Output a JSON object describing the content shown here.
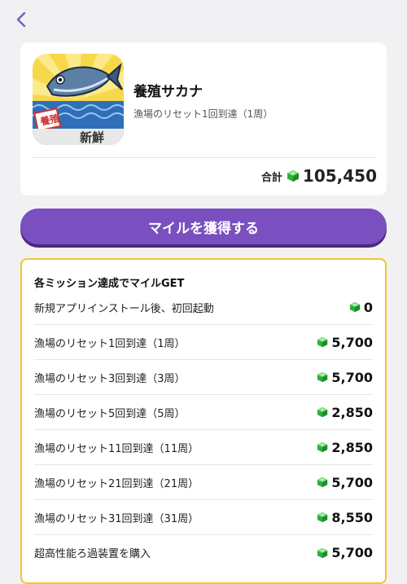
{
  "app": {
    "name": "養殖サカナ",
    "subtitle": "漁場のリセット1回到達（1周）",
    "icon_badge_left": "養殖",
    "icon_badge_bottom": "新鮮"
  },
  "total": {
    "label": "合計",
    "value": "105,450"
  },
  "earn_button": {
    "label": "マイルを獲得する"
  },
  "missions": {
    "title": "各ミッション達成でマイルGET",
    "rows": [
      {
        "label": "新規アプリインストール後、初回起動",
        "value": "0"
      },
      {
        "label": "漁場のリセット1回到達（1周）",
        "value": "5,700"
      },
      {
        "label": "漁場のリセット3回到達（3周）",
        "value": "5,700"
      },
      {
        "label": "漁場のリセット5回到達（5周）",
        "value": "2,850"
      },
      {
        "label": "漁場のリセット11回到達（11周）",
        "value": "2,850"
      },
      {
        "label": "漁場のリセット21回到達（21周）",
        "value": "5,700"
      },
      {
        "label": "漁場のリセット31回到達（31周）",
        "value": "8,550"
      },
      {
        "label": "超高性能ろ過装置を購入",
        "value": "5,700"
      }
    ]
  },
  "colors": {
    "accent": "#7a4fbf",
    "back_arrow": "#7a5bc4",
    "mission_border": "#f3c52c",
    "gem": "#3cc14a"
  },
  "icons": {
    "back": "chevron-left-icon",
    "currency": "green-gem-icon"
  }
}
